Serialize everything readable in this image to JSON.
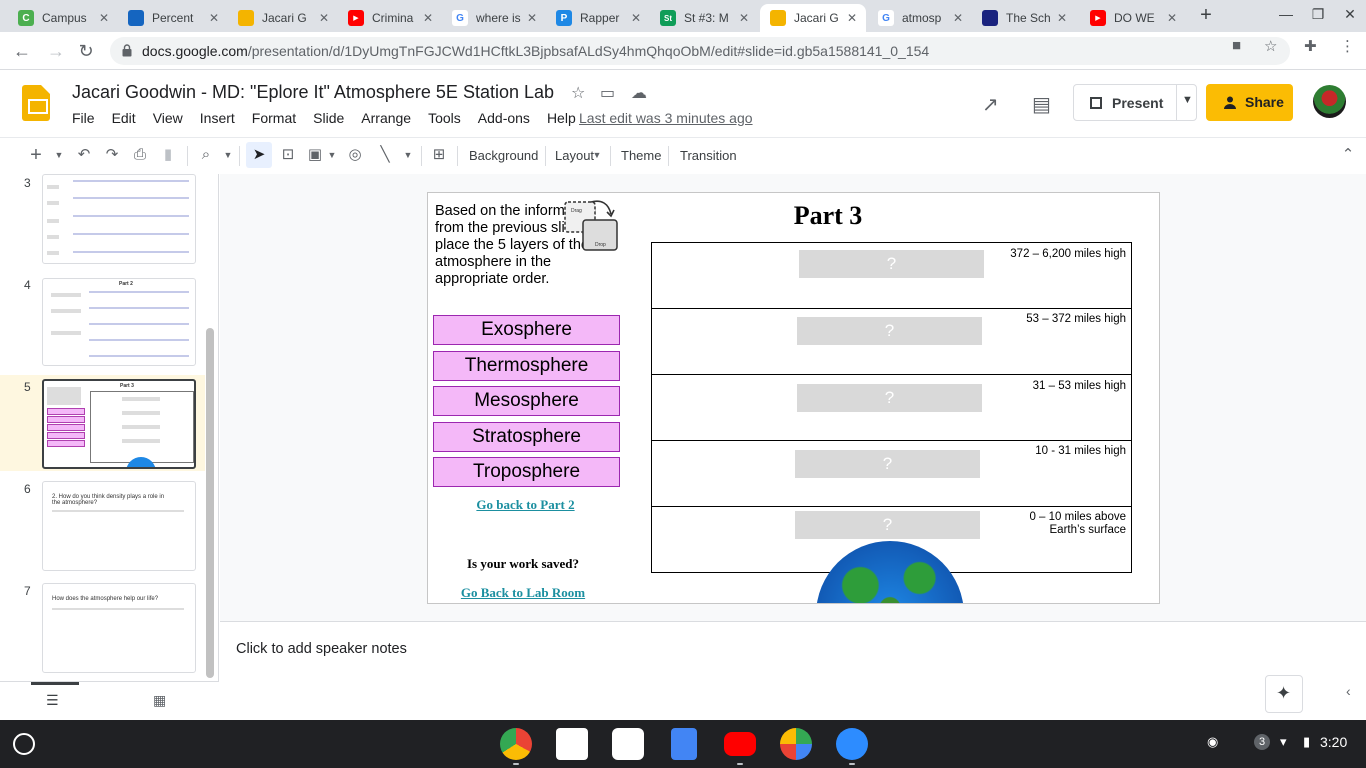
{
  "browser": {
    "tabs": [
      {
        "title": "Campus",
        "fav_color": "#4caf50",
        "fav_letter": "C"
      },
      {
        "title": "Percent",
        "fav_color": "#1565c0",
        "fav_letter": ""
      },
      {
        "title": "Jacari G",
        "fav_color": "#f4b400",
        "fav_letter": ""
      },
      {
        "title": "Crimina",
        "fav_color": "#ff0000",
        "fav_letter": "▶"
      },
      {
        "title": "where is",
        "fav_color": "#4285f4",
        "fav_letter": "G"
      },
      {
        "title": "Rapper",
        "fav_color": "#1e88e5",
        "fav_letter": "P"
      },
      {
        "title": "St #3: M",
        "fav_color": "#0f9d58",
        "fav_letter": "St"
      },
      {
        "title": "Jacari G",
        "fav_color": "#f4b400",
        "fav_letter": ""
      },
      {
        "title": "atmosp",
        "fav_color": "#4285f4",
        "fav_letter": "G"
      },
      {
        "title": "The Sch",
        "fav_color": "#1a237e",
        "fav_letter": ""
      },
      {
        "title": "DO WE",
        "fav_color": "#ff0000",
        "fav_letter": "▶"
      }
    ],
    "url_host": "docs.google.com",
    "url_path": "/presentation/d/1DyUmgTnFGJCWd1HCftkL3BjpbsafALdSy4hmQhqoObM/edit#slide=id.gb5a1588141_0_154"
  },
  "doc": {
    "title": "Jacari Goodwin - MD: \"Eplore It\" Atmosphere 5E Station Lab",
    "menu": [
      "File",
      "Edit",
      "View",
      "Insert",
      "Format",
      "Slide",
      "Arrange",
      "Tools",
      "Add-ons",
      "Help"
    ],
    "last_edit": "Last edit was 3 minutes ago",
    "present_label": "Present",
    "share_label": "Share"
  },
  "toolbar": {
    "background": "Background",
    "layout": "Layout",
    "theme": "Theme",
    "transition": "Transition"
  },
  "filmstrip": {
    "slides": [
      {
        "num": "3"
      },
      {
        "num": "4",
        "title": "Part 2"
      },
      {
        "num": "5",
        "title": "Part 3"
      },
      {
        "num": "6",
        "text": "2. How do you think density plays a role in the atmosphere?"
      },
      {
        "num": "7",
        "text": "How does the atmosphere help our life?"
      }
    ]
  },
  "slide": {
    "title": "Part 3",
    "instructions": "Based on the information from the previous slide, place the 5 layers of the atmosphere in the appropriate order.",
    "drag_label": "Drag",
    "drop_label": "Drop",
    "layers": [
      "Exosphere",
      "Thermosphere",
      "Mesosphere",
      "Stratosphere",
      "Troposphere"
    ],
    "back_part2": "Go back to Part 2",
    "saved_question": "Is your work saved?",
    "back_lab": "Go Back to Lab Room",
    "rows": [
      {
        "placeholder": "?",
        "altitude": "372 – 6,200 miles high"
      },
      {
        "placeholder": "?",
        "altitude": "53 – 372 miles high"
      },
      {
        "placeholder": "?",
        "altitude": "31 – 53 miles high"
      },
      {
        "placeholder": "?",
        "altitude": "10 - 31 miles high"
      },
      {
        "placeholder": "?",
        "altitude_line1": "0 – 10 miles above",
        "altitude_line2": "Earth’s surface"
      }
    ]
  },
  "notes": {
    "placeholder": "Click to add speaker notes"
  },
  "shelf": {
    "time": "3:20",
    "notification_count": "3"
  }
}
